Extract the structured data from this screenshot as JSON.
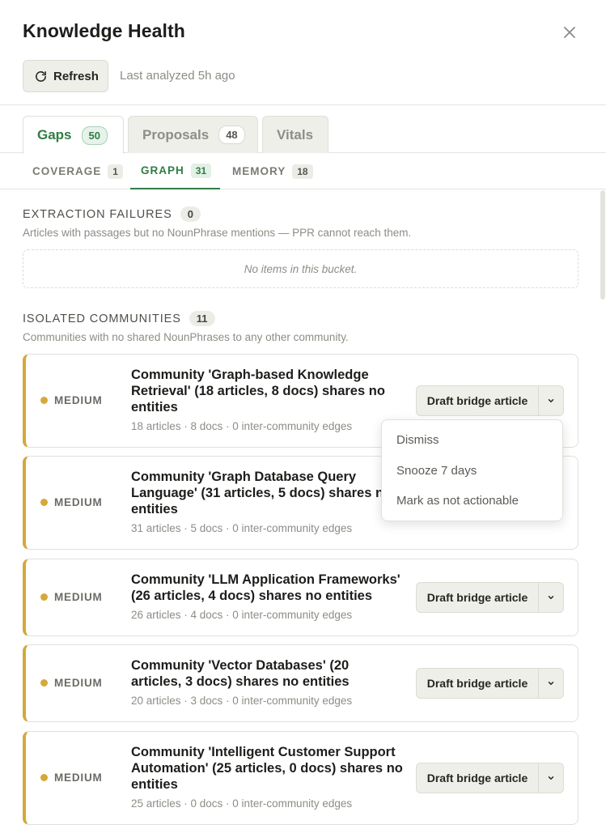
{
  "panel": {
    "title": "Knowledge Health",
    "refresh_label": "Refresh",
    "last_analyzed": "Last analyzed 5h ago"
  },
  "tabs": [
    {
      "label": "Gaps",
      "count": "50",
      "active": true
    },
    {
      "label": "Proposals",
      "count": "48",
      "active": false
    },
    {
      "label": "Vitals",
      "active": false
    }
  ],
  "subtabs": [
    {
      "label": "COVERAGE",
      "count": "1",
      "active": false
    },
    {
      "label": "GRAPH",
      "count": "31",
      "active": true
    },
    {
      "label": "MEMORY",
      "count": "18",
      "active": false
    }
  ],
  "extraction": {
    "title": "EXTRACTION FAILURES",
    "count": "0",
    "description": "Articles with passages but no NounPhrase mentions — PPR cannot reach them.",
    "empty_text": "No items in this bucket."
  },
  "isolated": {
    "title": "ISOLATED COMMUNITIES",
    "count": "11",
    "description": "Communities with no shared NounPhrases to any other community.",
    "action_label": "Draft bridge article",
    "cards": [
      {
        "severity": "MEDIUM",
        "title": "Community 'Graph-based Knowledge Retrieval' (18 articles, 8 docs) shares no entities",
        "meta": "18 articles · 8 docs · 0 inter-community edges"
      },
      {
        "severity": "MEDIUM",
        "title": "Community 'Graph Database Query Language' (31 articles, 5 docs) shares no entities",
        "meta": "31 articles · 5 docs · 0 inter-community edges"
      },
      {
        "severity": "MEDIUM",
        "title": "Community 'LLM Application Frameworks' (26 articles, 4 docs) shares no entities",
        "meta": "26 articles · 4 docs · 0 inter-community edges"
      },
      {
        "severity": "MEDIUM",
        "title": "Community 'Vector Databases' (20 articles, 3 docs) shares no entities",
        "meta": "20 articles · 3 docs · 0 inter-community edges"
      },
      {
        "severity": "MEDIUM",
        "title": "Community 'Intelligent Customer Support Automation' (25 articles, 0 docs) shares no entities",
        "meta": "25 articles · 0 docs · 0 inter-community edges"
      }
    ]
  },
  "dropdown_menu": {
    "items": [
      "Dismiss",
      "Snooze 7 days",
      "Mark as not actionable"
    ]
  },
  "colors": {
    "accent_green": "#2f7d46",
    "severity_medium": "#d4a93a"
  },
  "icons": {
    "close": "close-icon",
    "refresh": "refresh-icon",
    "caret": "chevron-down-icon"
  }
}
